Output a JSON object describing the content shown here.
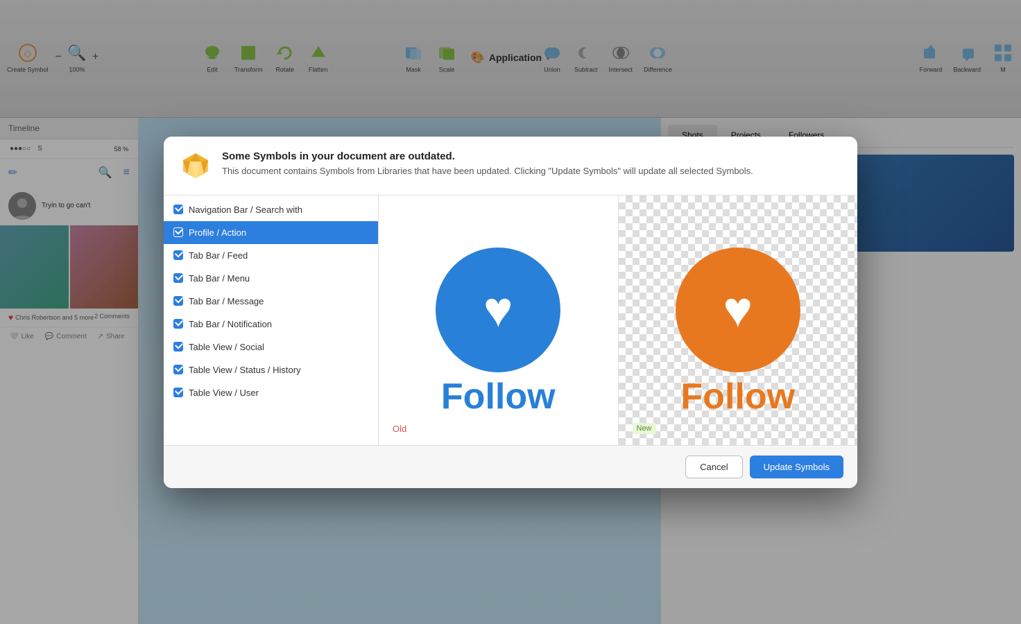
{
  "toolbar": {
    "title": "Application",
    "title_icon": "🎨",
    "tools": [
      {
        "id": "create-symbol",
        "label": "Create Symbol",
        "icon": "◇"
      },
      {
        "id": "zoom",
        "label": "100%",
        "icon": "🔍",
        "modifier_minus": "−",
        "modifier_plus": "+"
      },
      {
        "id": "edit",
        "label": "Edit",
        "icon": "✏️"
      },
      {
        "id": "transform",
        "label": "Transform",
        "icon": "⬛"
      },
      {
        "id": "rotate",
        "label": "Rotate",
        "icon": "↻"
      },
      {
        "id": "flatten",
        "label": "Flatten",
        "icon": "◆"
      },
      {
        "id": "mask",
        "label": "Mask",
        "icon": "⬡"
      },
      {
        "id": "scale",
        "label": "Scale",
        "icon": "⬡"
      },
      {
        "id": "union",
        "label": "Union",
        "icon": "⬟"
      },
      {
        "id": "subtract",
        "label": "Subtract",
        "icon": "⬟"
      },
      {
        "id": "intersect",
        "label": "Intersect",
        "icon": "⬟"
      },
      {
        "id": "difference",
        "label": "Difference",
        "icon": "⬟"
      },
      {
        "id": "forward",
        "label": "Forward",
        "icon": "↑"
      },
      {
        "id": "backward",
        "label": "Backward",
        "icon": "↓"
      }
    ]
  },
  "modal": {
    "title": "Some Symbols in your document are outdated.",
    "description": "This document contains Symbols from Libraries that have been updated. Clicking \"Update Symbols\" will update all selected Symbols.",
    "symbols_list": [
      {
        "id": 1,
        "label": "Navigation Bar / Search with",
        "checked": true
      },
      {
        "id": 2,
        "label": "Profile / Action",
        "checked": true,
        "selected": true
      },
      {
        "id": 3,
        "label": "Tab Bar / Feed",
        "checked": true
      },
      {
        "id": 4,
        "label": "Tab Bar / Menu",
        "checked": true
      },
      {
        "id": 5,
        "label": "Tab Bar / Message",
        "checked": true
      },
      {
        "id": 6,
        "label": "Tab Bar / Notification",
        "checked": true
      },
      {
        "id": 7,
        "label": "Table View / Social",
        "checked": true
      },
      {
        "id": 8,
        "label": "Table View / Status / History",
        "checked": true
      },
      {
        "id": 9,
        "label": "Table View / User",
        "checked": true
      }
    ],
    "preview": {
      "old_label": "Old",
      "new_label": "New",
      "old_text": "Follow",
      "new_text": "Follow",
      "old_color": "#2880d8",
      "new_color": "#e87820"
    },
    "cancel_label": "Cancel",
    "update_label": "Update Symbols"
  },
  "phone": {
    "status_dots": "●●●○○",
    "status_letter": "S",
    "battery": "58 %",
    "timeline_label": "Timeline",
    "nav_icon": "✏",
    "avatar_bg": "#666",
    "post_text": "Tryin to go can't",
    "like_text": "Chris Robertson and 5 more",
    "comment_text": "2 Comments",
    "like_label": "Like",
    "comment_label": "Comment",
    "share_label": "Share"
  },
  "right_panel": {
    "tabs": [
      {
        "id": "shots",
        "label": "Shots",
        "active": true
      },
      {
        "id": "projects",
        "label": "Projects"
      },
      {
        "id": "followers",
        "label": "Followers"
      }
    ]
  }
}
